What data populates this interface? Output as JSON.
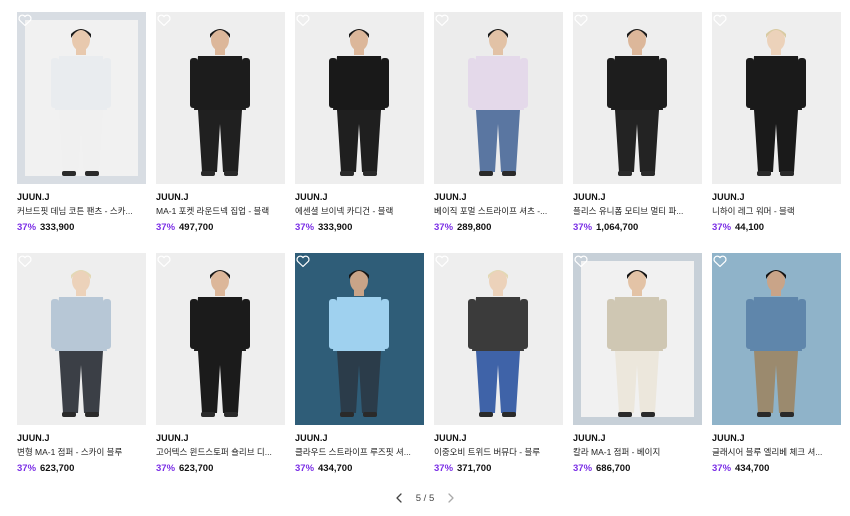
{
  "products": [
    {
      "brand": "JUUN.J",
      "name": "커브드핏 데님 코튼 팬츠 - 스카...",
      "discount": "37%",
      "price": "333,900",
      "bg": "#f1f1f1",
      "frame": "#d8dde3",
      "inset": true,
      "top": "#e9ecef",
      "bottom": "#f0f0f0",
      "hair": "#1b1b1b",
      "skin": "#e8c9ae"
    },
    {
      "brand": "JUUN.J",
      "name": "MA-1 포켓 라운드넥 집업 - 블랙",
      "discount": "37%",
      "price": "497,700",
      "bg": "#eeeeee",
      "frame": "#eeeeee",
      "inset": false,
      "top": "#1c1c1c",
      "bottom": "#202020",
      "hair": "#1a1a1a",
      "skin": "#dcb79a"
    },
    {
      "brand": "JUUN.J",
      "name": "에센셜 브이넥 카디건 - 블랙",
      "discount": "37%",
      "price": "333,900",
      "bg": "#eeeeee",
      "frame": "#eeeeee",
      "inset": false,
      "top": "#191919",
      "bottom": "#1f1f1f",
      "hair": "#1a1a1a",
      "skin": "#dcb79a"
    },
    {
      "brand": "JUUN.J",
      "name": "베이직 포멀 스트라이프 셔츠 -...",
      "discount": "37%",
      "price": "289,800",
      "bg": "#ececec",
      "frame": "#ececec",
      "inset": false,
      "top": "#e4d9ea",
      "bottom": "#5a76a1",
      "hair": "#1a1a1a",
      "skin": "#e2c2a6"
    },
    {
      "brand": "JUUN.J",
      "name": "플리스 유니폼 모티브 멀티 파...",
      "discount": "37%",
      "price": "1,064,700",
      "bg": "#eeeeee",
      "frame": "#eeeeee",
      "inset": false,
      "top": "#1d1d1d",
      "bottom": "#232323",
      "hair": "#1a1a1a",
      "skin": "#dcb79a"
    },
    {
      "brand": "JUUN.J",
      "name": "니하이 레그 워머 - 블랙",
      "discount": "37%",
      "price": "44,100",
      "bg": "#eeeeee",
      "frame": "#eeeeee",
      "inset": false,
      "top": "#1a1a1a",
      "bottom": "#1a1a1a",
      "hair": "#d9cba3",
      "skin": "#ecd2ba"
    },
    {
      "brand": "JUUN.J",
      "name": "변형 MA-1 점퍼 - 스카이 블루",
      "discount": "37%",
      "price": "623,700",
      "bg": "#eeeeee",
      "frame": "#eeeeee",
      "inset": false,
      "top": "#b7c7d6",
      "bottom": "#3b3f46",
      "hair": "#e3d8b5",
      "skin": "#ecd2ba"
    },
    {
      "brand": "JUUN.J",
      "name": "고어텍스 윈드스토퍼 숄리브 디...",
      "discount": "37%",
      "price": "623,700",
      "bg": "#eeeeee",
      "frame": "#eeeeee",
      "inset": false,
      "top": "#1b1b1b",
      "bottom": "#1b1b1b",
      "hair": "#1a1a1a",
      "skin": "#dcb79a"
    },
    {
      "brand": "JUUN.J",
      "name": "클라우드 스트라이프 루즈핏 셔...",
      "discount": "37%",
      "price": "434,700",
      "bg": "#2f5d78",
      "frame": "#2f5d78",
      "inset": false,
      "top": "#9fd1ef",
      "bottom": "#2b3c4a",
      "hair": "#141414",
      "skin": "#c9a488"
    },
    {
      "brand": "JUUN.J",
      "name": "이중오비 트위드 버뮤다 - 블루",
      "discount": "37%",
      "price": "371,700",
      "bg": "#eeeeee",
      "frame": "#eeeeee",
      "inset": false,
      "top": "#3b3b3b",
      "bottom": "#3f63a8",
      "hair": "#e3d8b5",
      "skin": "#ecd2ba"
    },
    {
      "brand": "JUUN.J",
      "name": "칼라 MA-1 점퍼 - 베이지",
      "discount": "37%",
      "price": "686,700",
      "bg": "#f1f1f1",
      "frame": "#c7d0d8",
      "inset": true,
      "top": "#cfc7b3",
      "bottom": "#ece7dc",
      "hair": "#141414",
      "skin": "#e3c3a6"
    },
    {
      "brand": "JUUN.J",
      "name": "글래시어 블루 엘리베 체크 셔...",
      "discount": "37%",
      "price": "434,700",
      "bg": "#8fb3c9",
      "frame": "#8fb3c9",
      "inset": false,
      "top": "#5f86ab",
      "bottom": "#9b8a6e",
      "hair": "#141414",
      "skin": "#c9a488"
    }
  ],
  "pagination": {
    "current": "5 / 5",
    "prev_icon": "chevron-left-icon",
    "next_icon": "chevron-right-icon"
  },
  "colors": {
    "discount": "#7b2fe6",
    "heart_stroke": "#ffffff"
  }
}
